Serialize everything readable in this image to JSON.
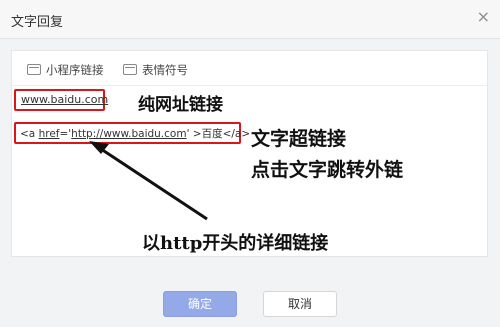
{
  "dialog": {
    "title": "文字回复",
    "close_glyph": "×"
  },
  "toolbar": {
    "mini_program_link": {
      "label": "小程序链接",
      "icon": "card-icon"
    },
    "emoji": {
      "label": "表情符号",
      "icon": "card-icon"
    }
  },
  "content": {
    "plain_url": "www.baidu.com",
    "code_prefix": "<a ",
    "code_href_attr": "href",
    "code_mid": "='",
    "code_url": "http://www.baidu.com",
    "code_suffix": "' >百度</a>"
  },
  "annotations": {
    "plain_url_label": "纯网址链接",
    "hyperlink_label": "文字超链接",
    "hyperlink_desc": "点击文字跳转外链",
    "http_label": "以http开头的详细链接"
  },
  "footer": {
    "confirm": "确定",
    "cancel": "取消"
  },
  "colors": {
    "highlight": "#d9161c",
    "primary_button": "#94a9e8"
  }
}
